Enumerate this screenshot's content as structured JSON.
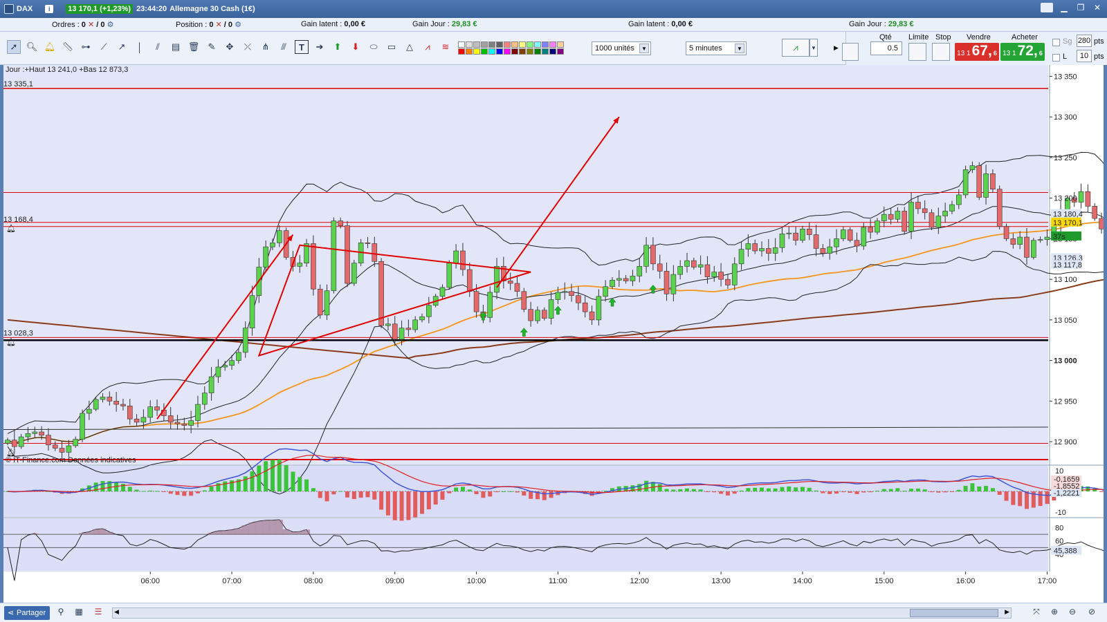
{
  "titlebar": {
    "symbol": "DAX",
    "info_icon": "i",
    "price_badge": "13 170,1 (+1,23%)",
    "time": "23:44:20",
    "instrument": "Allemagne 30 Cash (1€)",
    "icons": [
      "chart-app-icon",
      "menu-icon",
      "minimize-icon",
      "restore-icon",
      "close-icon"
    ]
  },
  "inforow": {
    "orders_label": "Ordres :",
    "orders_value": "0",
    "orders_value2": "/ 0",
    "position_label": "Position :",
    "position_value": "0",
    "position_value2": "/ 0",
    "latent1_label": "Gain latent :",
    "latent1_value": "0,00 €",
    "day1_label": "Gain Jour :",
    "day1_value": "29,83 €",
    "latent2_label": "Gain latent :",
    "latent2_value": "0,00 €",
    "day2_label": "Gain Jour :",
    "day2_value": "29,83 €"
  },
  "toolbar": {
    "units_select": "1000 unités",
    "interval_select": "5 minutes",
    "tools": [
      "pointer-tool-icon",
      "zoom-tool-icon",
      "alert-bell-icon",
      "ruler-icon",
      "horizontal-line-icon",
      "trend-line-icon",
      "ray-icon",
      "vertical-line-icon",
      "fan-icon",
      "fibonacci-icon",
      "delete-tool-icon",
      "magic-tool-icon",
      "channel-icon",
      "parallel-icon",
      "pitchfork-icon",
      "text-tool-icon",
      "arrow-right-icon",
      "arrow-up-icon",
      "arrow-down-icon",
      "ellipse-icon",
      "rectangle-icon",
      "triangle-icon",
      "zigzag-icon",
      "pattern-icon"
    ],
    "swatch_colors": [
      "#ffffff",
      "#e0e0e0",
      "#c0c0c0",
      "#a0a0a0",
      "#808080",
      "#606060",
      "#ff8080",
      "#ffc080",
      "#ffff80",
      "#80ff80",
      "#80ffff",
      "#8080ff",
      "#ff80ff",
      "#ffd0a0",
      "#ff0000",
      "#ff8000",
      "#ffff00",
      "#00c000",
      "#00ffff",
      "#0000ff",
      "#ff00ff",
      "#800000",
      "#804000",
      "#808000",
      "#008000",
      "#008080",
      "#000080",
      "#800080"
    ]
  },
  "trade_panel": {
    "qty_label": "Qté",
    "qty_value": "0.5",
    "limit_label": "Limite",
    "stop_label": "Stop",
    "sell_label": "Vendre",
    "buy_label": "Acheter",
    "sell_prefix": "13 1",
    "sell_big": "67,",
    "sell_sup": "6",
    "buy_prefix": "13 1",
    "buy_big": "72,",
    "buy_sup": "6",
    "sg_label": "Sg",
    "l_label": "L",
    "pts1_value": "280",
    "pts2_value": "10",
    "pts_label": "pts"
  },
  "chart_data": {
    "type": "candlestick",
    "interval": "5 minutes",
    "header_text": "Jour :+Haut 13 241,0 +Bas 12 873,3",
    "watermark": "© IT-Finance.com  Données indicatives",
    "price_axis": {
      "ticks": [
        13350,
        13300,
        13250,
        13200,
        13150,
        13100,
        13050,
        13000,
        12950,
        12900
      ],
      "tick_labels": [
        "13 350",
        "13 300",
        "13 250",
        "13 200",
        "13 150",
        "13 100",
        "13 050",
        "13 000",
        "12 950",
        "12 900"
      ],
      "range": [
        12872,
        13364
      ]
    },
    "time_axis": {
      "labels": [
        "06:00",
        "07:00",
        "08:00",
        "09:00",
        "10:00",
        "11:00",
        "12:00",
        "13:00",
        "14:00",
        "15:00",
        "16:00",
        "17:00"
      ],
      "first_label_bar": 21,
      "bars_per_hour": 12
    },
    "level_labels": [
      {
        "text": "13 335,1",
        "price": 13335.1
      },
      {
        "text": "13 168,4",
        "price": 13168.4
      },
      {
        "text": "13 028,3",
        "price": 13028.3
      }
    ],
    "horizontal_lines": [
      {
        "price": 13335.1,
        "color": "#e00000",
        "width": 1.5
      },
      {
        "price": 13207,
        "color": "#e00000",
        "width": 1
      },
      {
        "price": 13170.1,
        "color": "#e00000",
        "width": 1
      },
      {
        "price": 13165,
        "color": "#e00000",
        "width": 1
      },
      {
        "price": 13028.3,
        "color": "#e00000",
        "width": 1
      },
      {
        "price": 13025,
        "color": "#000000",
        "width": 2.5
      },
      {
        "price": 12898,
        "color": "#e00000",
        "width": 1
      },
      {
        "price": 12878,
        "color": "#e00000",
        "width": 2
      }
    ],
    "axis_badges": [
      {
        "text": "13 180,4",
        "price": 13180.4,
        "bg": "#dde6f6",
        "fg": "#222222"
      },
      {
        "text": "13 170,1",
        "price": 13170.1,
        "bg": "#ffd700",
        "fg": "#000000"
      },
      {
        "text": "37s",
        "price": 13153,
        "bg": "#1e9a2c",
        "fg": "#ffffff"
      },
      {
        "text": "13 126,3",
        "price": 13126.3,
        "bg": "#dde6f6",
        "fg": "#b01010"
      },
      {
        "text": "13 117,8",
        "price": 13117.8,
        "bg": "#dde6f6",
        "fg": "#c06000"
      }
    ],
    "closes": [
      12902,
      12894,
      12906,
      12910,
      12912,
      12908,
      12896,
      12892,
      12887,
      12895,
      12903,
      12935,
      12940,
      12952,
      12955,
      12950,
      12946,
      12944,
      12928,
      12924,
      12930,
      12943,
      12939,
      12932,
      12924,
      12922,
      12920,
      12926,
      12946,
      12960,
      12980,
      12992,
      12994,
      13000,
      13010,
      13040,
      13080,
      13115,
      13140,
      13145,
      13160,
      13127,
      13116,
      13120,
      13144,
      13088,
      13056,
      13086,
      13172,
      13166,
      13095,
      13120,
      13145,
      13144,
      13122,
      13043,
      13045,
      13026,
      13040,
      13038,
      13050,
      13054,
      13068,
      13079,
      13090,
      13120,
      13135,
      13112,
      13085,
      13060,
      13053,
      13084,
      13116,
      13098,
      13095,
      13085,
      13063,
      13049,
      13062,
      13052,
      13075,
      13084,
      13085,
      13080,
      13071,
      13060,
      13050,
      13079,
      13091,
      13099,
      13101,
      13098,
      13104,
      13116,
      13142,
      13119,
      13110,
      13082,
      13106,
      13116,
      13123,
      13115,
      13118,
      13103,
      13109,
      13100,
      13093,
      13119,
      13137,
      13144,
      13135,
      13138,
      13132,
      13139,
      13156,
      13157,
      13148,
      13162,
      13155,
      13138,
      13132,
      13140,
      13150,
      13161,
      13148,
      13141,
      13164,
      13158,
      13172,
      13180,
      13174,
      13184,
      13159,
      13195,
      13187,
      13182,
      13164,
      13178,
      13184,
      13192,
      13204,
      13235,
      13240,
      13201,
      13230,
      13211,
      13165,
      13150,
      13143,
      13152,
      13127,
      13148,
      13149,
      13152,
      13166,
      13186,
      13200,
      13195,
      13208,
      13190,
      13175,
      13162,
      13143,
      13163,
      13156,
      13160,
      13168,
      13170
    ],
    "annotations": [
      {
        "type": "arrow-line",
        "from": [
          22,
          12928
        ],
        "to": [
          42,
          13155
        ],
        "color": "#e00000"
      },
      {
        "type": "triangle",
        "points": [
          [
            43,
            13142
          ],
          [
            77,
            13109
          ],
          [
            37,
            13006
          ]
        ],
        "color": "#e00000"
      },
      {
        "type": "arrow-line",
        "from": [
          72,
          13090
        ],
        "to": [
          90,
          13300
        ],
        "color": "#e00000"
      }
    ],
    "buy_signals": [
      [
        70,
        13060
      ],
      [
        76,
        13040
      ],
      [
        81,
        13067
      ],
      [
        89,
        13077
      ],
      [
        95,
        13093
      ]
    ],
    "macd_panel": {
      "tick_labels": [
        "10",
        "-10"
      ],
      "badges": [
        {
          "text": "-0,1659",
          "bg": "#f7dada",
          "fg": "#d02020"
        },
        {
          "text": "-1,8552",
          "bg": "#f7dada",
          "fg": "#d02020"
        },
        {
          "text": "-1,2221",
          "bg": "#dde6f6",
          "fg": "#1a2fa8"
        }
      ]
    },
    "rsi_panel": {
      "tick_labels": [
        "80",
        "60",
        "40"
      ],
      "last_value_label": "45,388",
      "overbought": 70,
      "oversold": 30
    }
  },
  "bottombar": {
    "share_label": "Partager",
    "icons": [
      "chart-link-icon",
      "table-icon",
      "list-icon",
      "cursor-zoom-icon",
      "zoom-in-icon",
      "zoom-out-icon",
      "reset-zoom-icon"
    ]
  }
}
